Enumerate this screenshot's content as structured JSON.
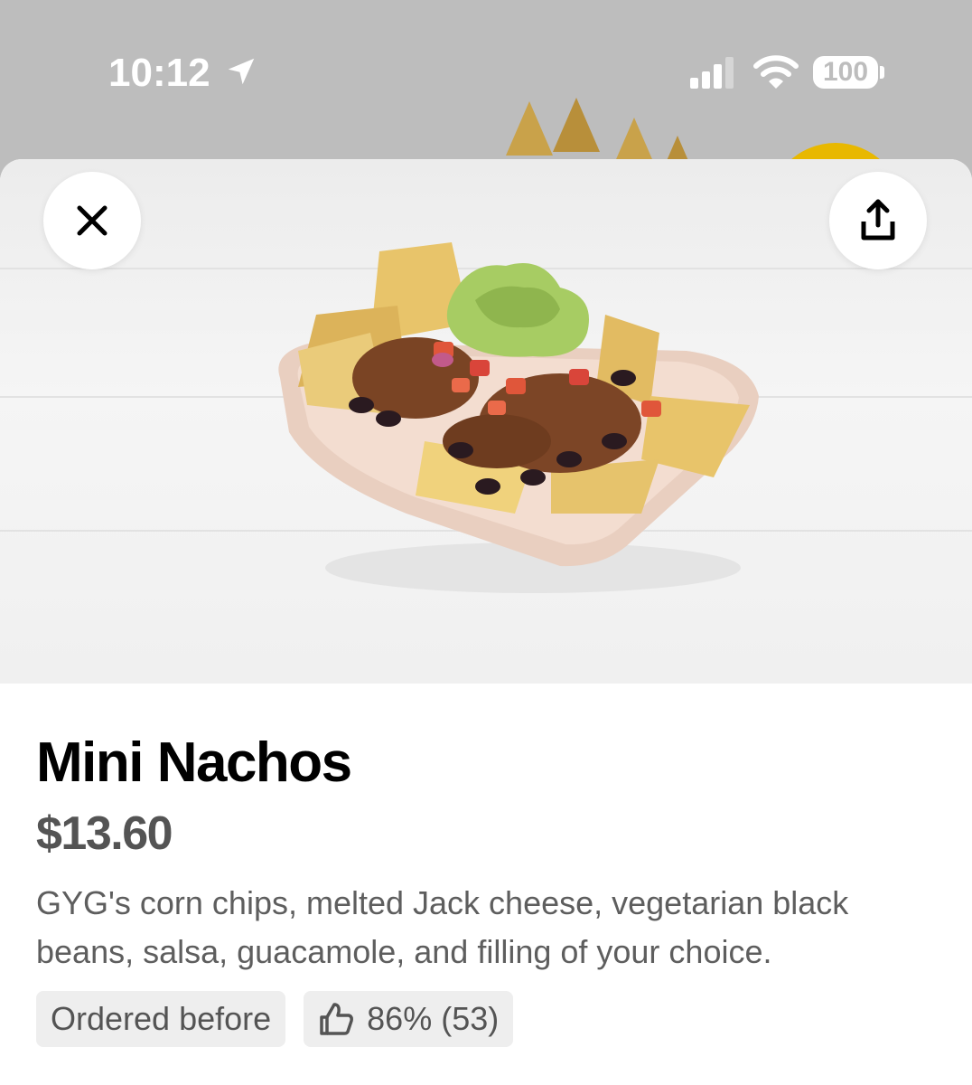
{
  "status_bar": {
    "time": "10:12",
    "battery": "100",
    "icons": [
      "location-arrow-icon",
      "signal-icon",
      "wifi-icon",
      "battery-icon"
    ]
  },
  "item": {
    "title": "Mini Nachos",
    "price": "$13.60",
    "description": "GYG's corn chips, melted Jack cheese, vegetarian black beans, salsa, guacamole, and filling of your choice."
  },
  "badges": {
    "ordered_before": "Ordered before",
    "rating": "86% (53)",
    "rating_icon": "thumbs-up-icon"
  },
  "actions": {
    "close_icon": "close-icon",
    "share_icon": "share-icon"
  },
  "colors": {
    "title": "#000000",
    "price": "#545454",
    "description": "#5e5e5e",
    "badge_bg": "#eeeeee"
  }
}
